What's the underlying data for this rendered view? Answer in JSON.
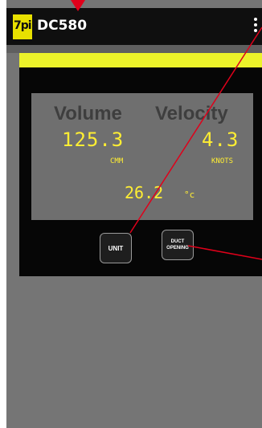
{
  "app": {
    "title": "DC580",
    "logo_text": "7pi"
  },
  "display": {
    "volume_label": "Volume",
    "velocity_label": "Velocity",
    "volume_value": "125.3",
    "volume_unit": "CMM",
    "velocity_value": "4.3",
    "velocity_unit": "KNOTS",
    "temperature_value": "26.2",
    "temperature_unit": "°c"
  },
  "buttons": {
    "unit_label": "UNIT",
    "duct_opening_label": "DUCT OPENING"
  },
  "colors": {
    "accent_yellow": "#ecf22a",
    "readout_yellow": "#ffee33",
    "annotation_red": "#e0001a"
  }
}
